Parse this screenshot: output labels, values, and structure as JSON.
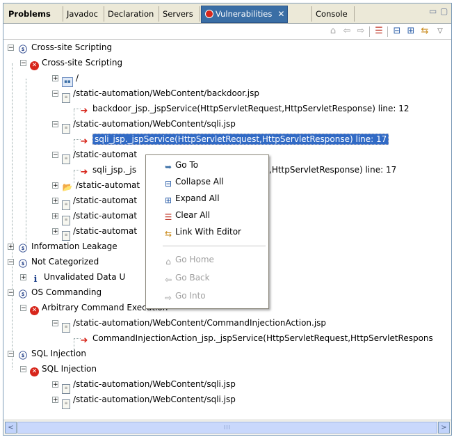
{
  "tabs": [
    {
      "label": "Problems",
      "bold": true
    },
    {
      "label": "Javadoc"
    },
    {
      "label": "Declaration"
    },
    {
      "label": "Servers"
    },
    {
      "label": "Vulnerabilities",
      "active": true
    },
    {
      "label": "Console"
    }
  ],
  "window_controls": {
    "minimize": "▭",
    "maximize": "▢"
  },
  "tab_close_glyph": "✕",
  "toolbar_icons": [
    "home-icon",
    "back-icon",
    "forward-icon",
    "clear-all-icon",
    "collapse-all-icon",
    "expand-all-icon",
    "link-with-editor-icon",
    "view-menu-icon"
  ],
  "tree": {
    "row1": "Cross-site Scripting",
    "row2": "Cross-site Scripting",
    "row3": "/",
    "row4": "/static-automation/WebContent/backdoor.jsp",
    "row5": "backdoor_jsp._jspService(HttpServletRequest,HttpServletResponse) line: 12",
    "row6": "/static-automation/WebContent/sqli.jsp",
    "row7": "sqli_jsp._jspService(HttpServletRequest,HttpServletResponse) line: 17",
    "row8": "/static-automat",
    "row9a": "sqli_jsp._js",
    "row9b": ",HttpServletResponse) line: 17",
    "row10": "/static-automat",
    "row11": "/static-automat",
    "row12": "/static-automat",
    "row13": "/static-automat",
    "row14": "Information Leakage",
    "row15": "Not Categorized",
    "row16": "Unvalidated Data U",
    "row17": "OS Commanding",
    "row18": "Arbitrary Command Execution",
    "row19": "/static-automation/WebContent/CommandInjectionAction.jsp",
    "row20": "CommandInjectionAction_jsp._jspService(HttpServletRequest,HttpServletRespons",
    "row21": "SQL Injection",
    "row22": "SQL Injection",
    "row23": "/static-automation/WebContent/sqli.jsp",
    "row24": "/static-automation/WebContent/sqli.jsp"
  },
  "context_menu": {
    "go_to": "Go To",
    "collapse_all": "Collapse All",
    "expand_all": "Expand All",
    "clear_all": "Clear All",
    "link_with_editor": "Link With Editor",
    "go_home": "Go Home",
    "go_back": "Go Back",
    "go_into": "Go Into"
  },
  "scrollbar": {
    "left": "<",
    "right": ">",
    "grip": "III"
  },
  "colors": {
    "selection": "#316ac5",
    "active_tab": "#3a6ea5",
    "error_red": "#d7261b"
  }
}
